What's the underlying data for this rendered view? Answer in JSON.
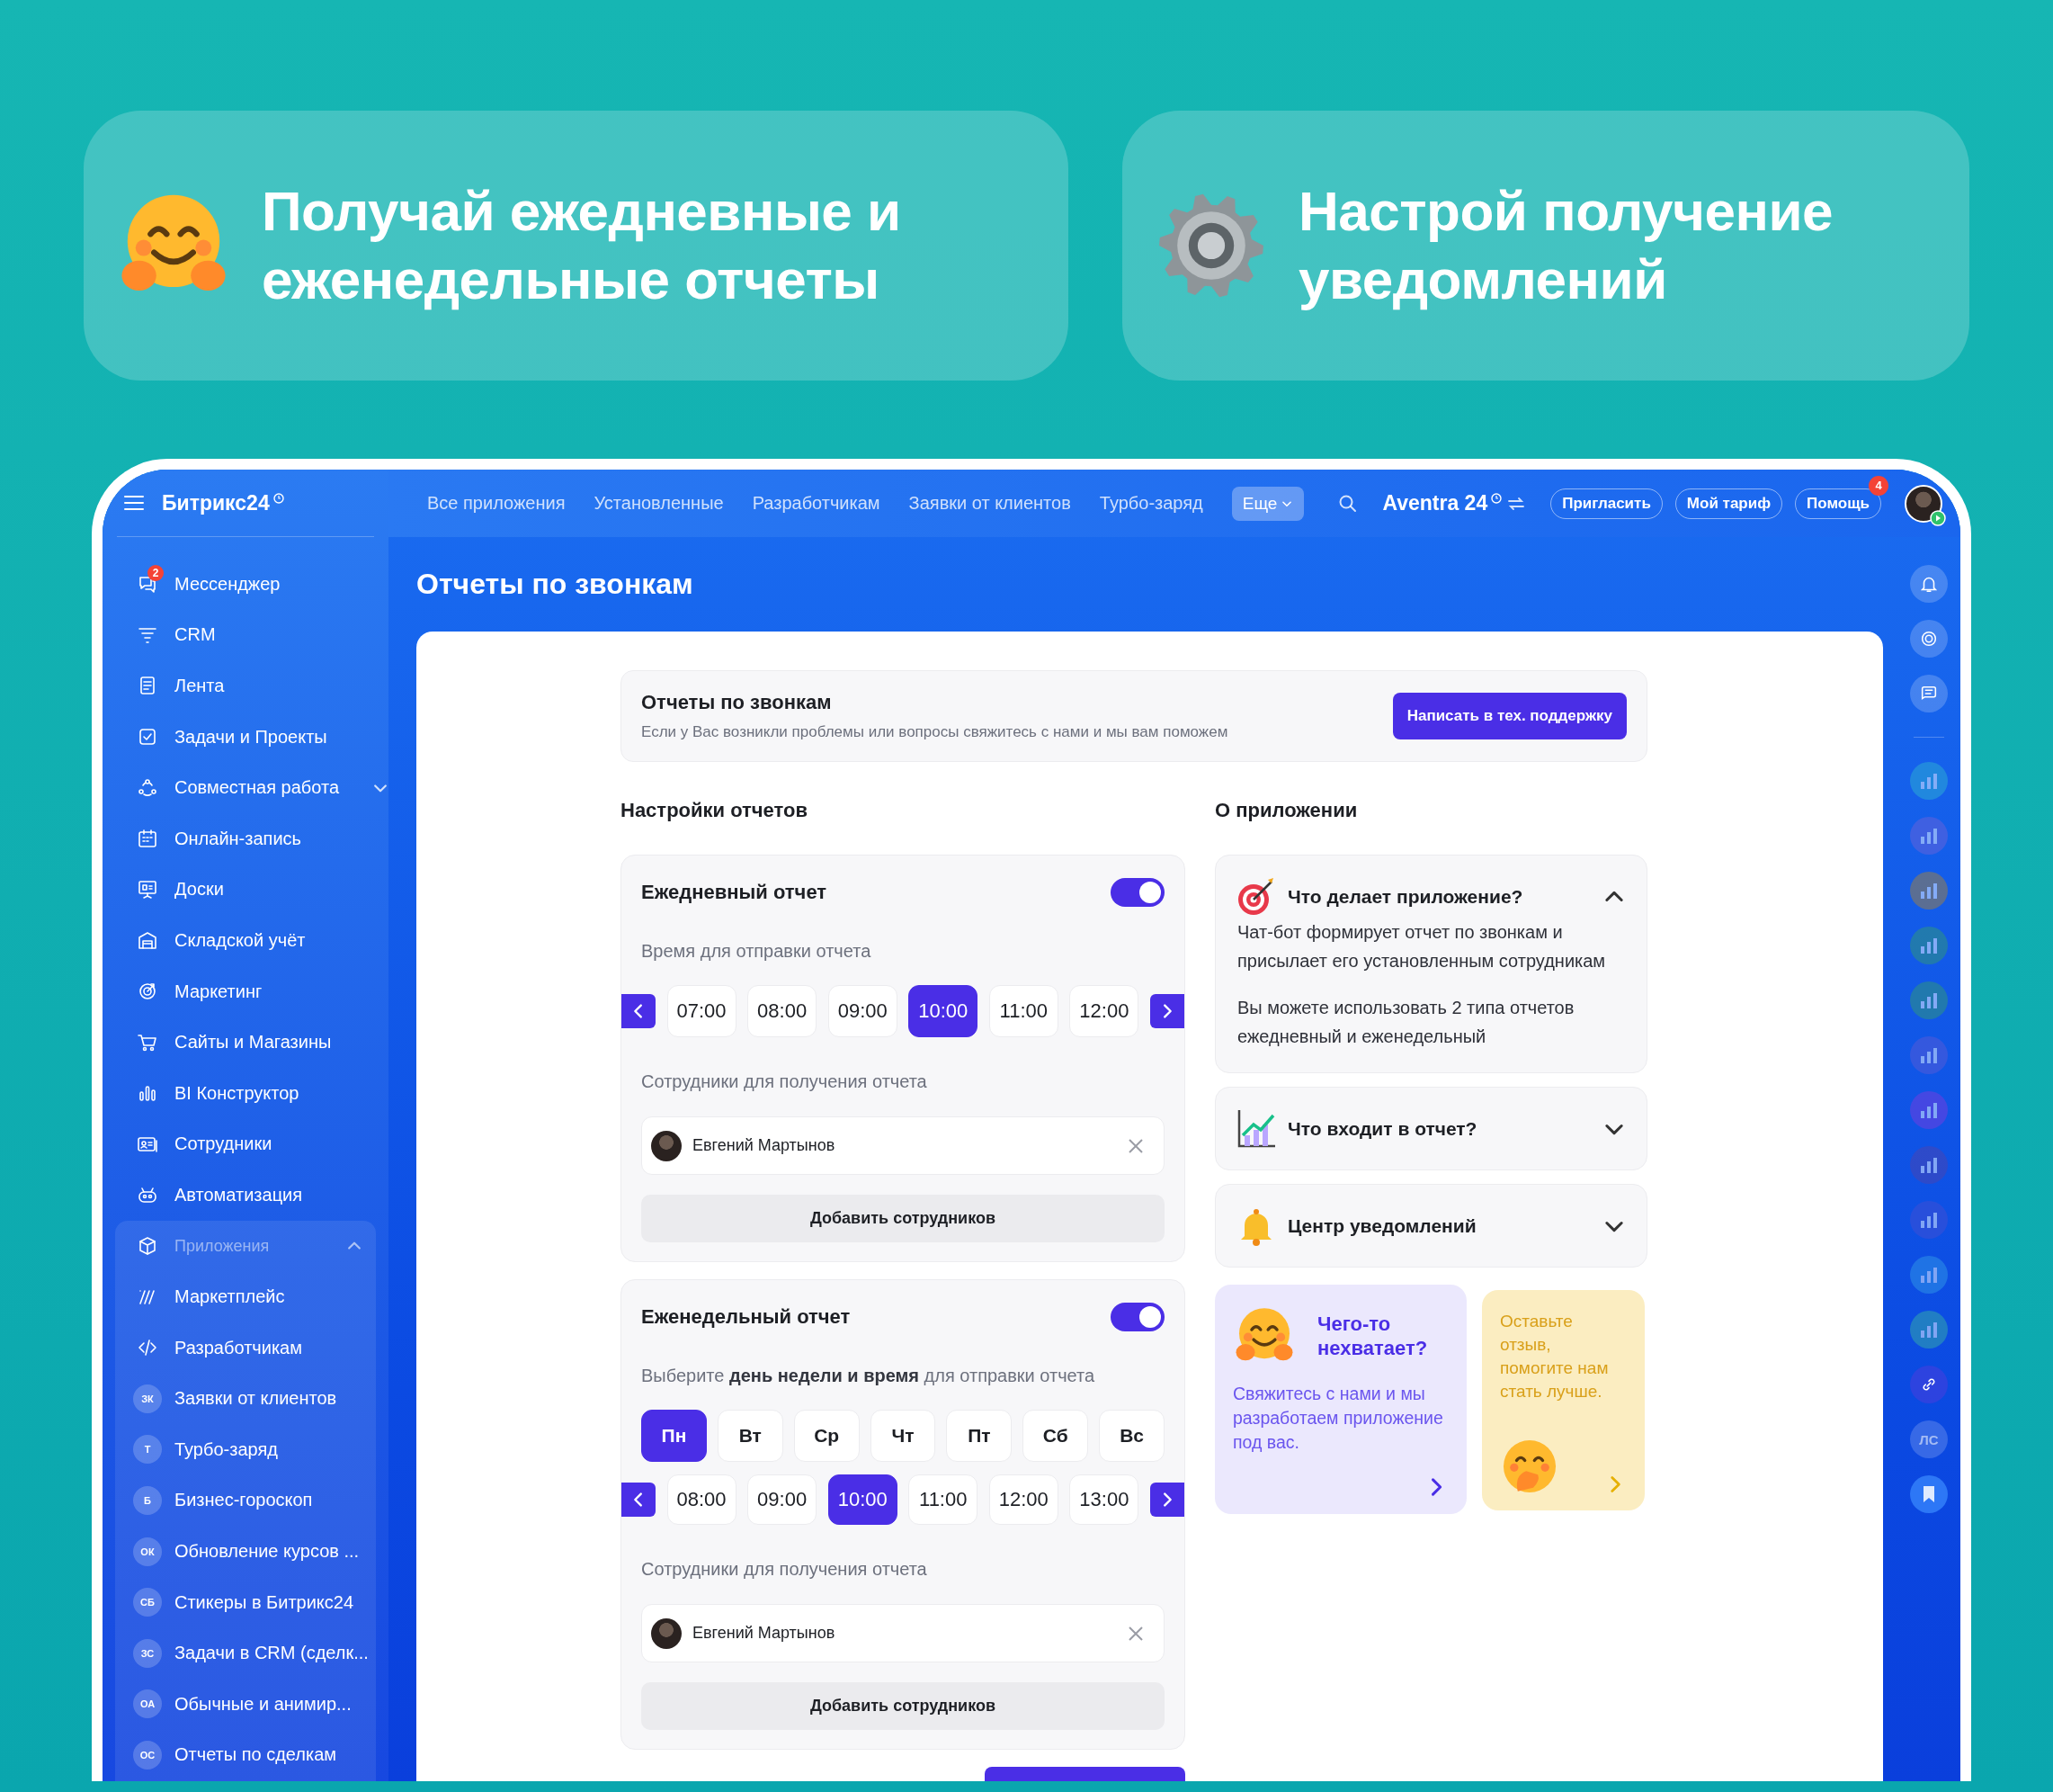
{
  "promo_banners": [
    {
      "text": "Получай ежедневные и еженедельные отчеты"
    },
    {
      "text": "Настрой получение уведомлений"
    }
  ],
  "sidebar": {
    "logo": "Битрикс24",
    "items": [
      {
        "kind": "link",
        "label": "Мессенджер",
        "badge": "2"
      },
      {
        "kind": "link",
        "label": "CRM"
      },
      {
        "kind": "link",
        "label": "Лента"
      },
      {
        "kind": "link",
        "label": "Задачи и Проекты"
      },
      {
        "kind": "submenu",
        "label": "Совместная работа"
      },
      {
        "kind": "link",
        "label": "Онлайн-запись"
      },
      {
        "kind": "link",
        "label": "Доски"
      },
      {
        "kind": "link",
        "label": "Складской учёт"
      },
      {
        "kind": "link",
        "label": "Маркетинг"
      },
      {
        "kind": "link",
        "label": "Сайты и Магазины"
      },
      {
        "kind": "link",
        "label": "BI Конструктор"
      },
      {
        "kind": "link",
        "label": "Сотрудники"
      },
      {
        "kind": "link",
        "label": "Автоматизация"
      }
    ],
    "group": {
      "label": "Приложения",
      "expanded": true,
      "items": [
        {
          "kind": "link",
          "label": "Маркетплейс"
        },
        {
          "kind": "link",
          "label": "Разработчикам"
        },
        {
          "kind": "app",
          "initials": "ЗК",
          "label": "Заявки от клиентов"
        },
        {
          "kind": "app",
          "initials": "Т",
          "label": "Турбо-заряд"
        },
        {
          "kind": "app",
          "initials": "Б",
          "label": "Бизнес-гороскоп"
        },
        {
          "kind": "app",
          "initials": "ОК",
          "label": "Обновление курсов ..."
        },
        {
          "kind": "app",
          "initials": "СБ",
          "label": "Стикеры в Битрикс24"
        },
        {
          "kind": "app",
          "initials": "ЗС",
          "label": "Задачи в CRM (сделк..."
        },
        {
          "kind": "app",
          "initials": "ОА",
          "label": "Обычные и анимир..."
        },
        {
          "kind": "app",
          "initials": "ОС",
          "label": "Отчеты по сделкам"
        }
      ]
    }
  },
  "topbar": {
    "nav": [
      "Все приложения",
      "Установленные",
      "Разработчикам",
      "Заявки от клиентов",
      "Турбо-заряд"
    ],
    "more": "Еще",
    "portal": "Aventra 24",
    "buttons": [
      {
        "label": "Пригласить"
      },
      {
        "label": "Мой тариф"
      },
      {
        "label": "Помощь",
        "badge": "4"
      }
    ]
  },
  "right_rail": [
    {
      "kind": "bell"
    },
    {
      "kind": "goal"
    },
    {
      "kind": "chat"
    },
    {
      "kind": "app"
    },
    {
      "kind": "app"
    },
    {
      "kind": "app"
    },
    {
      "kind": "app"
    },
    {
      "kind": "app"
    },
    {
      "kind": "app"
    },
    {
      "kind": "app"
    },
    {
      "kind": "app"
    },
    {
      "kind": "app"
    },
    {
      "kind": "app"
    },
    {
      "kind": "app"
    },
    {
      "kind": "link"
    },
    {
      "kind": "initials",
      "label": "ЛС"
    },
    {
      "kind": "bookmark"
    }
  ],
  "page": {
    "title": "Отчеты по звонкам",
    "header": {
      "title": "Отчеты по звонкам",
      "subtitle": "Если у Вас возникли проблемы или вопросы свяжитесь с нами и мы вам поможем",
      "button": "Написать в тех. поддержку"
    },
    "settings": {
      "title": "Настройки отчетов",
      "reports": [
        {
          "title": "Ежедневный отчет",
          "on": true,
          "time_label": "Время для отправки отчета",
          "times": [
            {
              "label": "07:00",
              "selected": false
            },
            {
              "label": "08:00",
              "selected": false
            },
            {
              "label": "09:00",
              "selected": false
            },
            {
              "label": "10:00",
              "selected": true
            },
            {
              "label": "11:00",
              "selected": false
            },
            {
              "label": "12:00",
              "selected": false
            }
          ],
          "employees_label": "Сотрудники для получения отчета",
          "employees": [
            {
              "name": "Евгений Мартынов"
            }
          ],
          "add_button": "Добавить сотрудников"
        },
        {
          "title": "Еженедельный отчет",
          "on": true,
          "time_label": "Выберите **день недели и время** для отправки отчета",
          "days": [
            {
              "label": "Пн",
              "selected": true
            },
            {
              "label": "Вт",
              "selected": false
            },
            {
              "label": "Ср",
              "selected": false
            },
            {
              "label": "Чт",
              "selected": false
            },
            {
              "label": "Пт",
              "selected": false
            },
            {
              "label": "Сб",
              "selected": false
            },
            {
              "label": "Вс",
              "selected": false
            }
          ],
          "times": [
            {
              "label": "08:00",
              "selected": false
            },
            {
              "label": "09:00",
              "selected": false
            },
            {
              "label": "10:00",
              "selected": true
            },
            {
              "label": "11:00",
              "selected": false
            },
            {
              "label": "12:00",
              "selected": false
            },
            {
              "label": "13:00",
              "selected": false
            }
          ],
          "employees_label": "Сотрудники для получения отчета",
          "employees": [
            {
              "name": "Евгений Мартынов"
            }
          ],
          "add_button": "Добавить сотрудников"
        }
      ]
    },
    "about": {
      "title": "О приложении",
      "sections": [
        {
          "title": "Что делает приложение?",
          "expanded": true,
          "paragraphs": [
            "Чат-бот формирует отчет по звонкам и присылает его установленным сотрудникам",
            "Вы можете использовать 2 типа отчетов ежедневный и еженедельный"
          ]
        },
        {
          "title": "Что входит в отчет?",
          "expanded": false
        },
        {
          "title": "Центр уведомлений",
          "expanded": false
        }
      ],
      "cards": [
        {
          "kind": "feature",
          "title": "Чего-то нехватает?",
          "text": "Свяжитесь с нами и мы разработаем приложение под вас."
        },
        {
          "kind": "feedback",
          "text": "Оставьте отзыв, помогите нам стать лучше."
        }
      ]
    }
  }
}
